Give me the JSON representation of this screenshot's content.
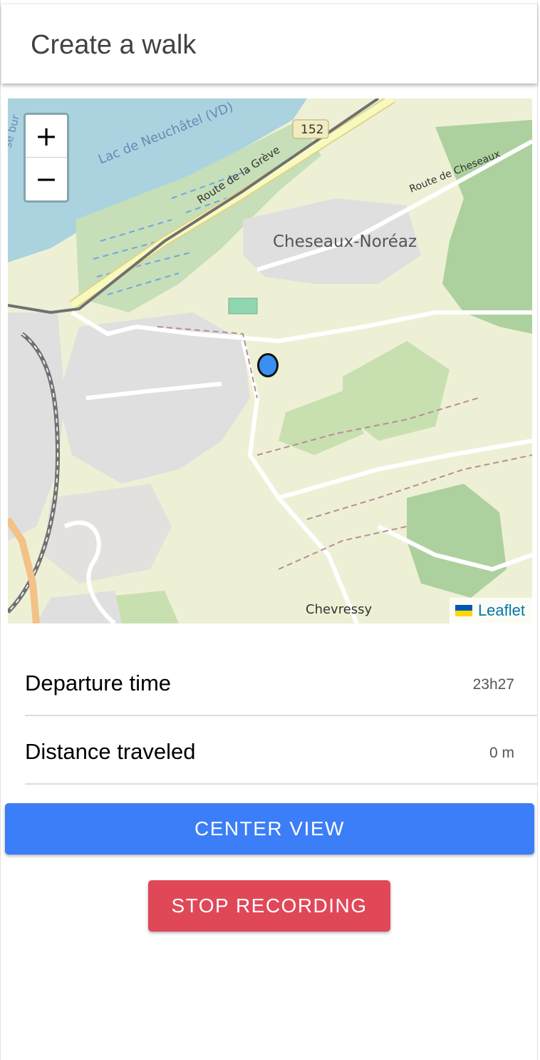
{
  "header": {
    "title": "Create a walk"
  },
  "map": {
    "zoom_in_label": "+",
    "zoom_out_label": "−",
    "attribution": "Leaflet",
    "labels": {
      "lake": "Lac de Neuchâtel (VD)",
      "road_greve": "Route de la Grève",
      "road_cheseaux": "Route de Cheseaux",
      "town": "Cheseaux-Noréaz",
      "village": "Chevressy",
      "route_number": "152",
      "edge_label": "se bur"
    },
    "colors": {
      "water": "#aad3df",
      "wetland": "#c6dfb8",
      "forest": "#add19e",
      "residential": "#e0dfdf",
      "farmland": "#eef0d5",
      "road_major": "#f7fabf",
      "rail": "#707070"
    }
  },
  "info": {
    "departure_label": "Departure time",
    "departure_value": "23h27",
    "distance_label": "Distance traveled",
    "distance_value": "0 m"
  },
  "buttons": {
    "center_view": "CENTER VIEW",
    "stop_recording": "STOP RECORDING"
  },
  "theme": {
    "primary": "#3c7ef7",
    "danger": "#e04858",
    "marker": "#3b8ff0"
  }
}
